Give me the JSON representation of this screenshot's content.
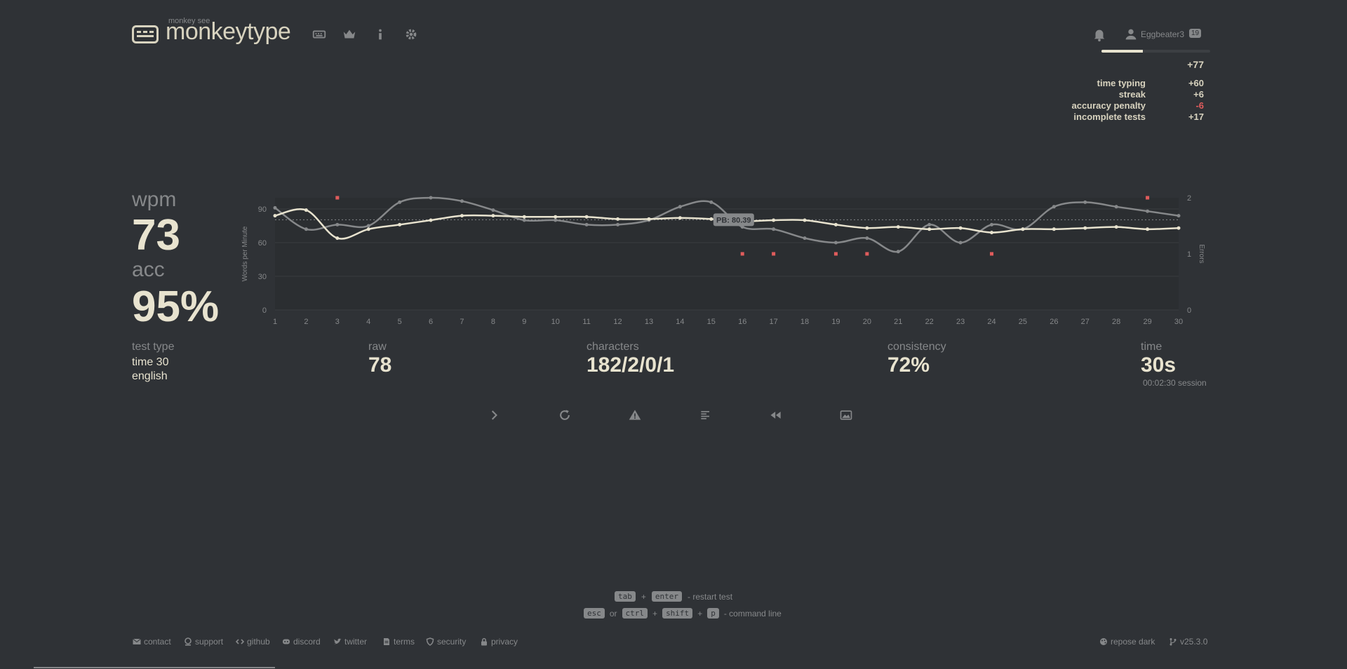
{
  "header": {
    "logo_small": "monkey see",
    "logo_text": "monkeytype",
    "username": "Eggbeater3",
    "level": "19",
    "xp_progress": 0.38
  },
  "xp": {
    "total": "+77",
    "rows": [
      {
        "label": "time typing",
        "value": "+60"
      },
      {
        "label": "streak",
        "value": "+6"
      },
      {
        "label": "accuracy penalty",
        "value": "-6"
      },
      {
        "label": "incomplete tests",
        "value": "+17"
      }
    ]
  },
  "stats": {
    "wpm_label": "wpm",
    "wpm": "73",
    "acc_label": "acc",
    "acc": "95%"
  },
  "bottom": {
    "test_type_label": "test type",
    "test_type_1": "time 30",
    "test_type_2": "english",
    "raw_label": "raw",
    "raw": "78",
    "characters_label": "characters",
    "characters": "182/2/0/1",
    "consistency_label": "consistency",
    "consistency": "72%",
    "time_label": "time",
    "time": "30s",
    "session": "00:02:30 session"
  },
  "chart_data": {
    "type": "line",
    "x": [
      1,
      2,
      3,
      4,
      5,
      6,
      7,
      8,
      9,
      10,
      11,
      12,
      13,
      14,
      15,
      16,
      17,
      18,
      19,
      20,
      21,
      22,
      23,
      24,
      25,
      26,
      27,
      28,
      29,
      30
    ],
    "series": [
      {
        "name": "wpm",
        "values": [
          84,
          89,
          64,
          72,
          76,
          80,
          84,
          84,
          83,
          83,
          83,
          81,
          81,
          82,
          81,
          79,
          80,
          80,
          76,
          73,
          74,
          72,
          73,
          69,
          72,
          72,
          73,
          74,
          72,
          73
        ]
      },
      {
        "name": "raw",
        "values": [
          91,
          72,
          76,
          75,
          96,
          100,
          97,
          89,
          80,
          80,
          76,
          76,
          80,
          92,
          96,
          74,
          72,
          64,
          60,
          64,
          52,
          76,
          60,
          76,
          72,
          92,
          96,
          92,
          88,
          84
        ]
      },
      {
        "name": "errors",
        "values": [
          0,
          0,
          2,
          0,
          0,
          0,
          0,
          0,
          0,
          0,
          0,
          0,
          0,
          0,
          0,
          1,
          1,
          0,
          1,
          1,
          0,
          0,
          0,
          1,
          0,
          0,
          0,
          0,
          2,
          0
        ]
      }
    ],
    "pb": 80.39,
    "pb_label": "PB: 80.39",
    "ylabel": "Words per Minute",
    "y2label": "Errors",
    "ylim": [
      0,
      100
    ],
    "y_ticks": [
      0,
      30,
      60,
      90
    ],
    "y2_ticks": [
      0,
      1,
      2
    ],
    "y2lim": [
      0,
      2
    ]
  },
  "actions": [
    "next-test",
    "restart",
    "report",
    "words-history",
    "replay",
    "screenshot"
  ],
  "hints": {
    "line1": {
      "k1": "tab",
      "plus": "+",
      "k2": "enter",
      "text": "- restart test"
    },
    "line2": {
      "k1": "esc",
      "or": "or",
      "k2": "ctrl",
      "plus1": "+",
      "k3": "shift",
      "plus2": "+",
      "k4": "p",
      "text": "- command line"
    }
  },
  "footer": {
    "links": [
      "contact",
      "support",
      "github",
      "discord",
      "twitter",
      "terms",
      "security",
      "privacy"
    ],
    "theme": "repose dark",
    "version": "v25.3.0"
  },
  "colors": {
    "background": "#2f3236",
    "text": "#e8e3cf",
    "sub": "#86888a",
    "error": "#e05c5c"
  }
}
